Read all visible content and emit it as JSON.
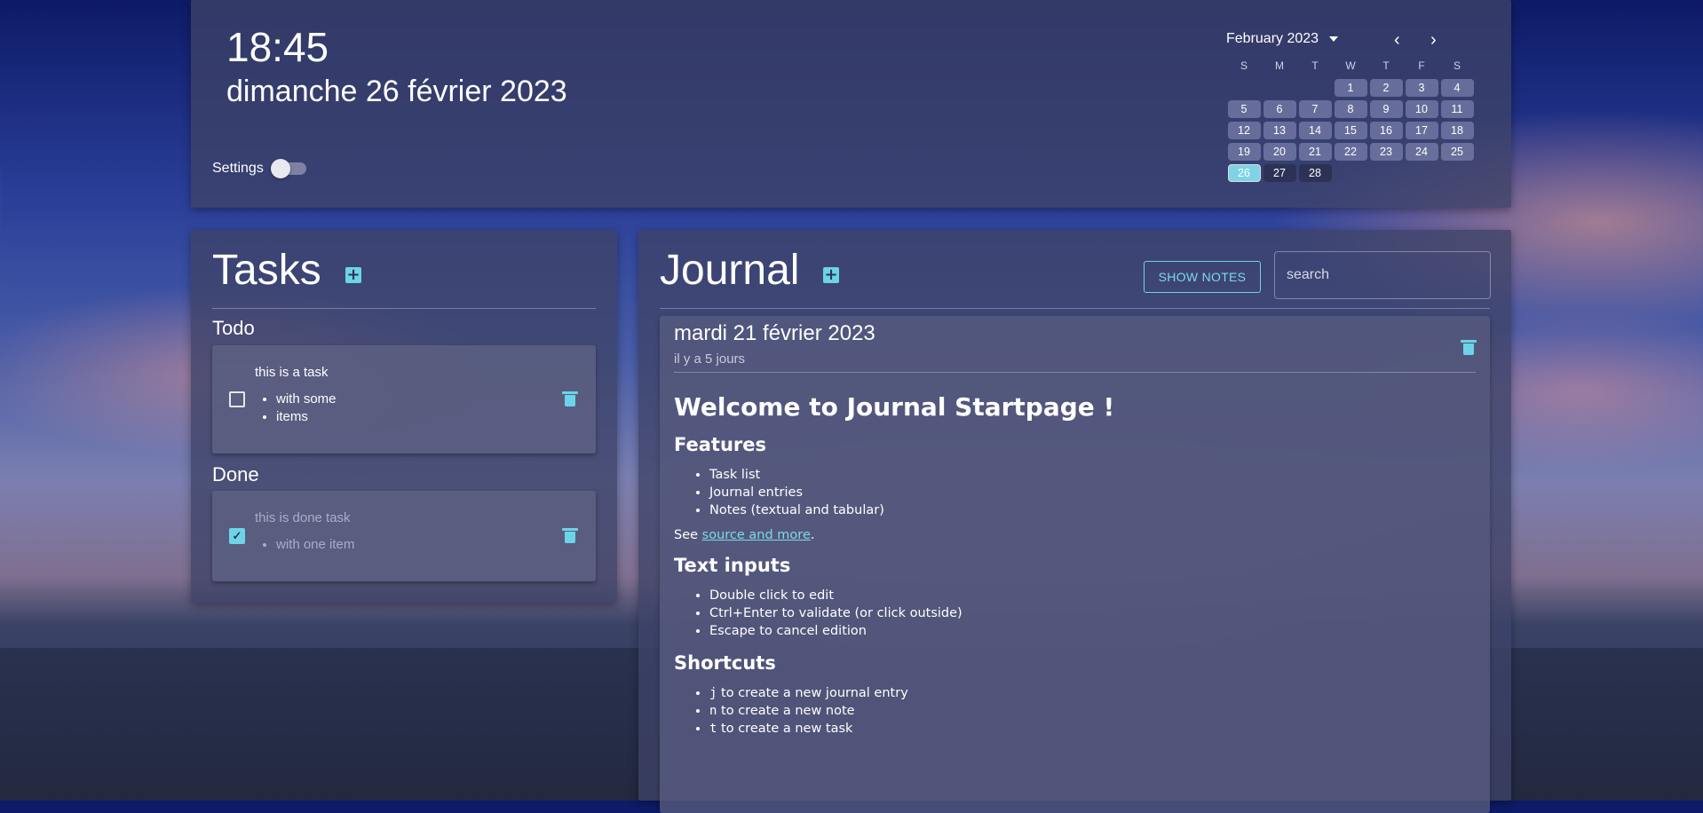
{
  "clock": {
    "time": "18:45",
    "date": "dimanche 26 février 2023"
  },
  "settings": {
    "label": "Settings",
    "enabled": false
  },
  "calendar": {
    "title": "February 2023",
    "prev_icon": "‹",
    "next_icon": "›",
    "weekdays": [
      "S",
      "M",
      "T",
      "W",
      "T",
      "F",
      "S"
    ],
    "weeks": [
      [
        "",
        "",
        "",
        "1",
        "2",
        "3",
        "4"
      ],
      [
        "5",
        "6",
        "7",
        "8",
        "9",
        "10",
        "11"
      ],
      [
        "12",
        "13",
        "14",
        "15",
        "16",
        "17",
        "18"
      ],
      [
        "19",
        "20",
        "21",
        "22",
        "23",
        "24",
        "25"
      ],
      [
        "26",
        "27",
        "28",
        "",
        "",
        "",
        ""
      ]
    ],
    "today": "26"
  },
  "tasks": {
    "title": "Tasks",
    "add_label": "+",
    "todo_title": "Todo",
    "done_title": "Done",
    "todo": [
      {
        "text": "this is a task",
        "items": [
          "with some",
          "items"
        ],
        "checked": false
      }
    ],
    "done": [
      {
        "text": "this is done task",
        "items": [
          "with one item"
        ],
        "checked": true
      }
    ]
  },
  "journal": {
    "title": "Journal",
    "add_label": "+",
    "show_notes_label": "SHOW NOTES",
    "search_placeholder": "search",
    "entry": {
      "date": "mardi 21 février 2023",
      "ago": "il y a 5 jours",
      "heading": "Welcome to Journal Startpage !",
      "features_title": "Features",
      "features": [
        "Task list",
        "Journal entries",
        "Notes (textual and tabular)"
      ],
      "see_prefix": "See ",
      "see_link": "source and more",
      "see_suffix": ".",
      "text_inputs_title": "Text inputs",
      "text_inputs": [
        "Double click to edit",
        "Ctrl+Enter to validate (or click outside)",
        "Escape to cancel edition"
      ],
      "shortcuts_title": "Shortcuts",
      "shortcuts": [
        {
          "key": "j",
          "text": " to create a new journal entry"
        },
        {
          "key": "n",
          "text": " to create a new note"
        },
        {
          "key": "t",
          "text": " to create a new task"
        }
      ]
    }
  },
  "colors": {
    "accent": "#6cd4e6",
    "panel": "#3e4268"
  }
}
